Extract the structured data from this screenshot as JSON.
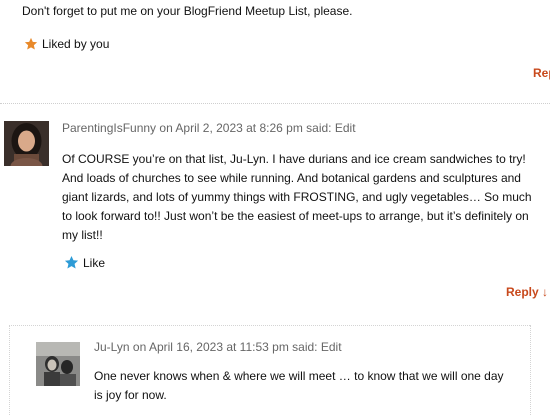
{
  "comment_top": {
    "text": "Don't forget to put me on your BlogFriend Meetup List, please.",
    "liked_label": "Liked by you",
    "reply_label": "Repl"
  },
  "comment_parenting": {
    "author": "ParentingIsFunny",
    "meta_rest": "on April 2, 2023 at 8:26 pm said:",
    "edit_label": "Edit",
    "body_lines": [
      "Of COURSE you’re on that list, Ju-Lyn. I have durians and ice cream sandwiches to try!",
      "And loads of churches to see while running. And botanical gardens and sculptures and",
      "giant lizards, and lots of yummy things with FROSTING, and ugly vegetables… So much",
      "to look forward to!! Just won’t be the easiest of meet-ups to arrange, but it’s definitely on",
      "my list!!"
    ],
    "like_label": "Like",
    "reply_label": "Reply ↓"
  },
  "comment_julyn": {
    "author": "Ju-Lyn",
    "meta_rest": "on April 16, 2023 at 11:53 pm said:",
    "edit_label": "Edit",
    "body_lines": [
      "One never knows when & where we will meet … to know that we will one day",
      "is joy for now."
    ]
  },
  "colors": {
    "liked_star": "#e8892a",
    "like_star": "#2d9bd6",
    "reply_link": "#c8491c"
  },
  "icons": {
    "liked": "star-filled-orange",
    "like": "star-filled-blue"
  }
}
